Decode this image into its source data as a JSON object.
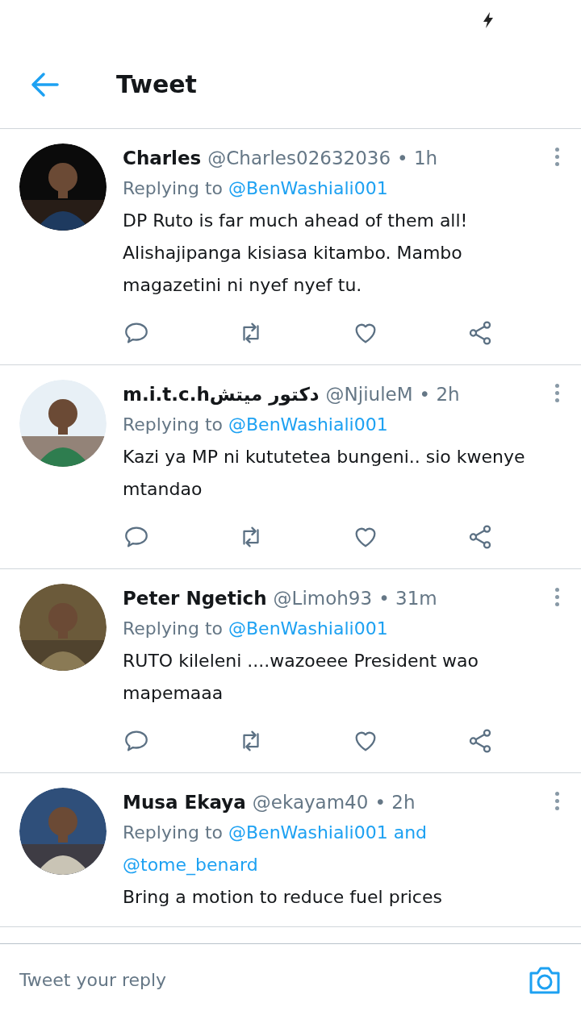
{
  "header": {
    "title": "Tweet"
  },
  "tweets": [
    {
      "name": "Charles",
      "handle": "@Charles02632036",
      "time": "• 1h",
      "replying_label": "Replying to",
      "reply_to": [
        "@BenWashiali001"
      ],
      "text": "DP Ruto is far much ahead of them all! Alishajipanga kisiasa kitambo. Mambo magazetini ni nyef nyef tu.",
      "show_actions": true
    },
    {
      "name": "m.i.t.c.hدكتور ميتش",
      "handle": "@NjiuleM",
      "time": "• 2h",
      "replying_label": "Replying to",
      "reply_to": [
        "@BenWashiali001"
      ],
      "text": "Kazi ya MP ni kututetea bungeni.. sio kwenye mtandao",
      "show_actions": true
    },
    {
      "name": "Peter Ngetich",
      "handle": "@Limoh93",
      "time": "• 31m",
      "replying_label": "Replying to",
      "reply_to": [
        "@BenWashiali001"
      ],
      "text": "RUTO kileleni ....wazoeee President wao mapemaaa",
      "show_actions": true
    },
    {
      "name": "Musa Ekaya",
      "handle": "@ekayam40",
      "time": "• 2h",
      "replying_label": "Replying to",
      "reply_to": [
        "@BenWashiali001",
        "@tome_benard"
      ],
      "joiner": "and",
      "text": "Bring a motion to reduce fuel prices",
      "show_actions": false
    }
  ],
  "reply_bar": {
    "placeholder": "Tweet your reply"
  }
}
